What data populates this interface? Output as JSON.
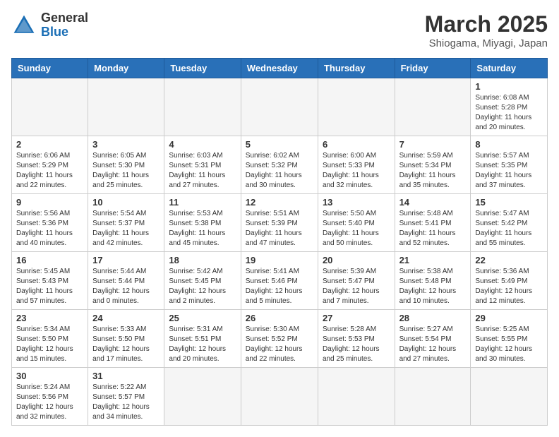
{
  "header": {
    "logo_general": "General",
    "logo_blue": "Blue",
    "month_title": "March 2025",
    "subtitle": "Shiogama, Miyagi, Japan"
  },
  "days_of_week": [
    "Sunday",
    "Monday",
    "Tuesday",
    "Wednesday",
    "Thursday",
    "Friday",
    "Saturday"
  ],
  "weeks": [
    [
      {
        "day": "",
        "info": ""
      },
      {
        "day": "",
        "info": ""
      },
      {
        "day": "",
        "info": ""
      },
      {
        "day": "",
        "info": ""
      },
      {
        "day": "",
        "info": ""
      },
      {
        "day": "",
        "info": ""
      },
      {
        "day": "1",
        "info": "Sunrise: 6:08 AM\nSunset: 5:28 PM\nDaylight: 11 hours\nand 20 minutes."
      }
    ],
    [
      {
        "day": "2",
        "info": "Sunrise: 6:06 AM\nSunset: 5:29 PM\nDaylight: 11 hours\nand 22 minutes."
      },
      {
        "day": "3",
        "info": "Sunrise: 6:05 AM\nSunset: 5:30 PM\nDaylight: 11 hours\nand 25 minutes."
      },
      {
        "day": "4",
        "info": "Sunrise: 6:03 AM\nSunset: 5:31 PM\nDaylight: 11 hours\nand 27 minutes."
      },
      {
        "day": "5",
        "info": "Sunrise: 6:02 AM\nSunset: 5:32 PM\nDaylight: 11 hours\nand 30 minutes."
      },
      {
        "day": "6",
        "info": "Sunrise: 6:00 AM\nSunset: 5:33 PM\nDaylight: 11 hours\nand 32 minutes."
      },
      {
        "day": "7",
        "info": "Sunrise: 5:59 AM\nSunset: 5:34 PM\nDaylight: 11 hours\nand 35 minutes."
      },
      {
        "day": "8",
        "info": "Sunrise: 5:57 AM\nSunset: 5:35 PM\nDaylight: 11 hours\nand 37 minutes."
      }
    ],
    [
      {
        "day": "9",
        "info": "Sunrise: 5:56 AM\nSunset: 5:36 PM\nDaylight: 11 hours\nand 40 minutes."
      },
      {
        "day": "10",
        "info": "Sunrise: 5:54 AM\nSunset: 5:37 PM\nDaylight: 11 hours\nand 42 minutes."
      },
      {
        "day": "11",
        "info": "Sunrise: 5:53 AM\nSunset: 5:38 PM\nDaylight: 11 hours\nand 45 minutes."
      },
      {
        "day": "12",
        "info": "Sunrise: 5:51 AM\nSunset: 5:39 PM\nDaylight: 11 hours\nand 47 minutes."
      },
      {
        "day": "13",
        "info": "Sunrise: 5:50 AM\nSunset: 5:40 PM\nDaylight: 11 hours\nand 50 minutes."
      },
      {
        "day": "14",
        "info": "Sunrise: 5:48 AM\nSunset: 5:41 PM\nDaylight: 11 hours\nand 52 minutes."
      },
      {
        "day": "15",
        "info": "Sunrise: 5:47 AM\nSunset: 5:42 PM\nDaylight: 11 hours\nand 55 minutes."
      }
    ],
    [
      {
        "day": "16",
        "info": "Sunrise: 5:45 AM\nSunset: 5:43 PM\nDaylight: 11 hours\nand 57 minutes."
      },
      {
        "day": "17",
        "info": "Sunrise: 5:44 AM\nSunset: 5:44 PM\nDaylight: 12 hours\nand 0 minutes."
      },
      {
        "day": "18",
        "info": "Sunrise: 5:42 AM\nSunset: 5:45 PM\nDaylight: 12 hours\nand 2 minutes."
      },
      {
        "day": "19",
        "info": "Sunrise: 5:41 AM\nSunset: 5:46 PM\nDaylight: 12 hours\nand 5 minutes."
      },
      {
        "day": "20",
        "info": "Sunrise: 5:39 AM\nSunset: 5:47 PM\nDaylight: 12 hours\nand 7 minutes."
      },
      {
        "day": "21",
        "info": "Sunrise: 5:38 AM\nSunset: 5:48 PM\nDaylight: 12 hours\nand 10 minutes."
      },
      {
        "day": "22",
        "info": "Sunrise: 5:36 AM\nSunset: 5:49 PM\nDaylight: 12 hours\nand 12 minutes."
      }
    ],
    [
      {
        "day": "23",
        "info": "Sunrise: 5:34 AM\nSunset: 5:50 PM\nDaylight: 12 hours\nand 15 minutes."
      },
      {
        "day": "24",
        "info": "Sunrise: 5:33 AM\nSunset: 5:50 PM\nDaylight: 12 hours\nand 17 minutes."
      },
      {
        "day": "25",
        "info": "Sunrise: 5:31 AM\nSunset: 5:51 PM\nDaylight: 12 hours\nand 20 minutes."
      },
      {
        "day": "26",
        "info": "Sunrise: 5:30 AM\nSunset: 5:52 PM\nDaylight: 12 hours\nand 22 minutes."
      },
      {
        "day": "27",
        "info": "Sunrise: 5:28 AM\nSunset: 5:53 PM\nDaylight: 12 hours\nand 25 minutes."
      },
      {
        "day": "28",
        "info": "Sunrise: 5:27 AM\nSunset: 5:54 PM\nDaylight: 12 hours\nand 27 minutes."
      },
      {
        "day": "29",
        "info": "Sunrise: 5:25 AM\nSunset: 5:55 PM\nDaylight: 12 hours\nand 30 minutes."
      }
    ],
    [
      {
        "day": "30",
        "info": "Sunrise: 5:24 AM\nSunset: 5:56 PM\nDaylight: 12 hours\nand 32 minutes."
      },
      {
        "day": "31",
        "info": "Sunrise: 5:22 AM\nSunset: 5:57 PM\nDaylight: 12 hours\nand 34 minutes."
      },
      {
        "day": "",
        "info": ""
      },
      {
        "day": "",
        "info": ""
      },
      {
        "day": "",
        "info": ""
      },
      {
        "day": "",
        "info": ""
      },
      {
        "day": "",
        "info": ""
      }
    ]
  ]
}
